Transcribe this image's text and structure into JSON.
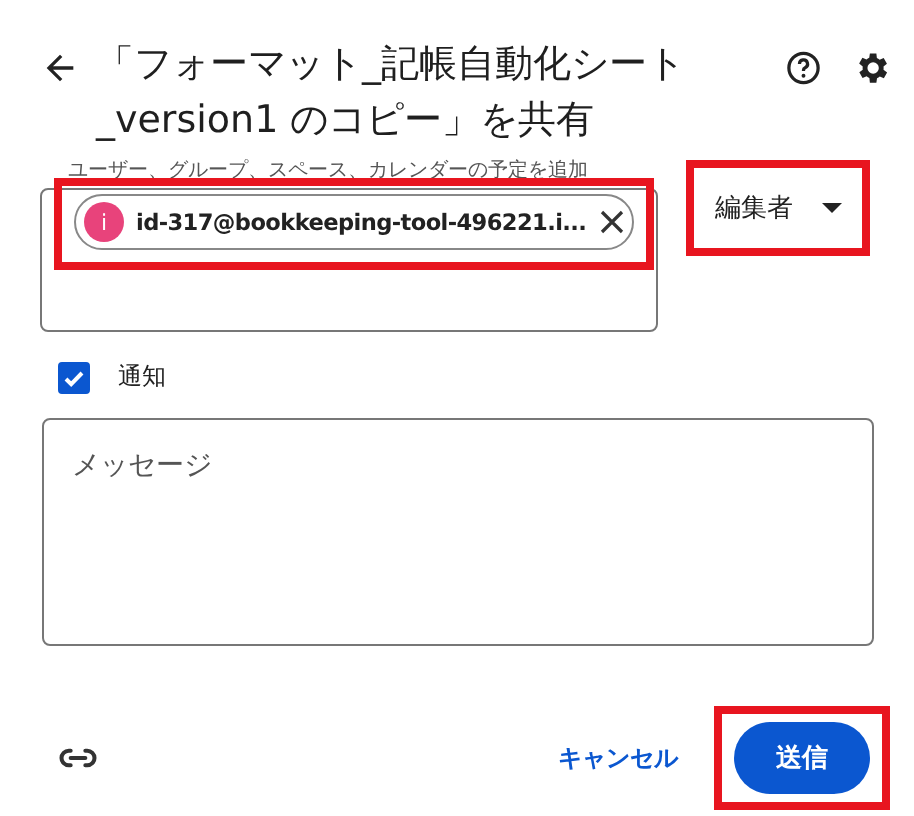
{
  "dialog": {
    "title": "「フォーマット_記帳自動化シート _version1 のコピー」を共有"
  },
  "recipients": {
    "label": "ユーザー、グループ、スペース、カレンダーの予定を追加",
    "chips": [
      {
        "initial": "i",
        "email": "id-317@bookkeeping-tool-496221.i...",
        "color": "#e8437b"
      }
    ]
  },
  "role": {
    "value": "編集者"
  },
  "notify": {
    "label": "通知",
    "checked": true
  },
  "message": {
    "placeholder": "メッセージ"
  },
  "buttons": {
    "cancel": "キャンセル",
    "send": "送信"
  }
}
